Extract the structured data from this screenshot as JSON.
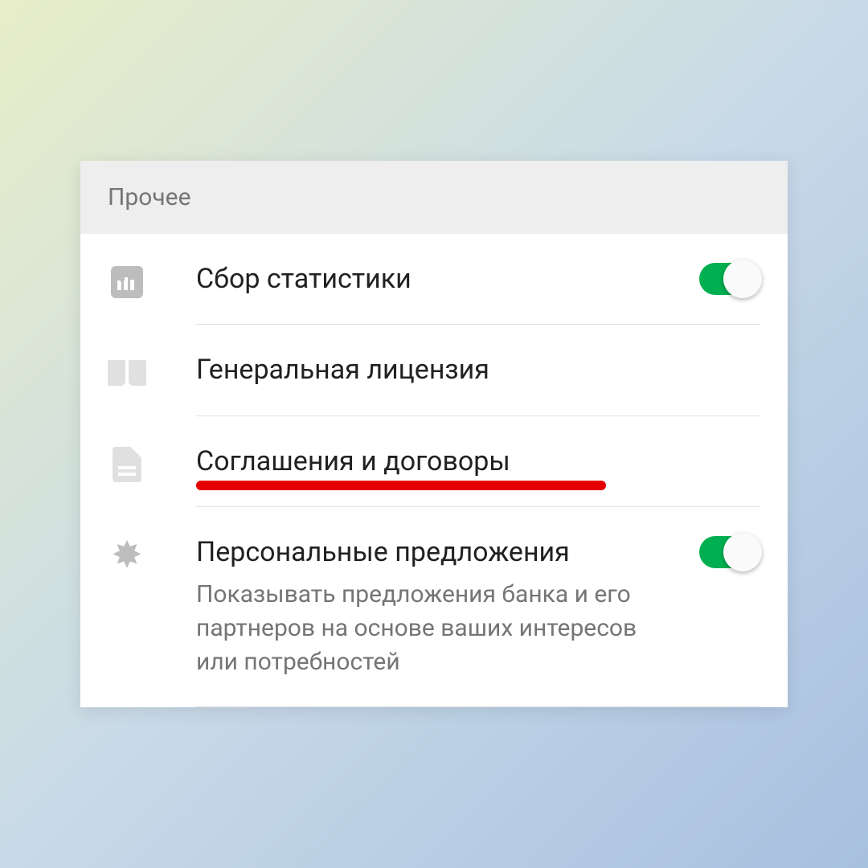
{
  "section": {
    "title": "Прочее"
  },
  "items": {
    "stats": {
      "label": "Сбор статистики",
      "toggle_on": true
    },
    "license": {
      "label": "Генеральная лицензия"
    },
    "agreements": {
      "label": "Соглашения и договоры",
      "highlighted": true
    },
    "offers": {
      "label": "Персональные предложения",
      "description": "Показывать предложения банка и его партнеров на основе ваших интересов или потребностей",
      "toggle_on": true
    }
  },
  "colors": {
    "toggle_on": "#00b050",
    "highlight": "#e60000",
    "icon": "#bdbdbd"
  }
}
